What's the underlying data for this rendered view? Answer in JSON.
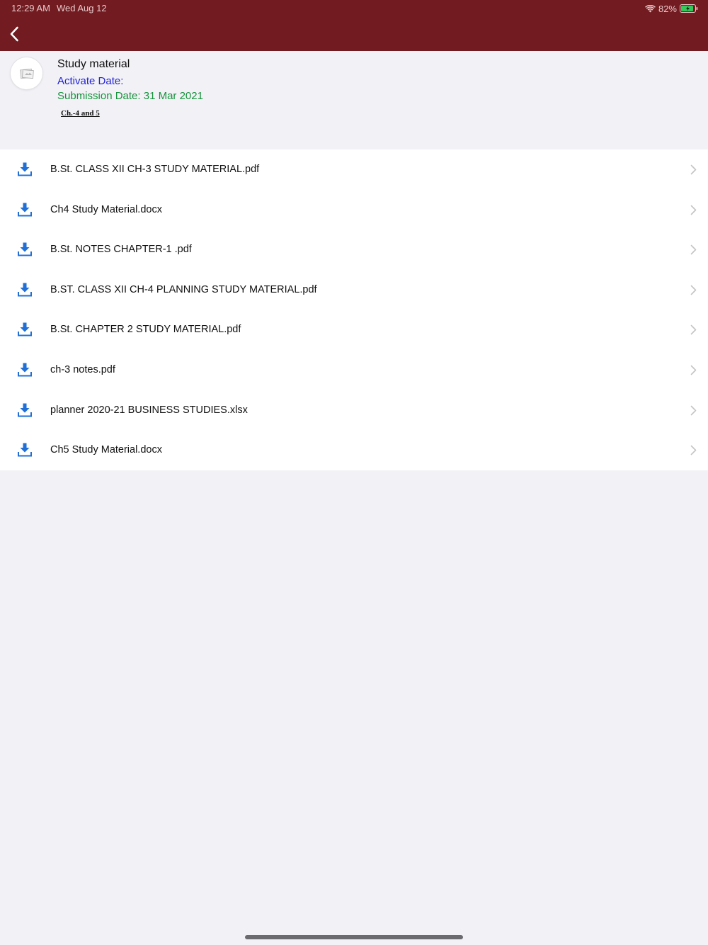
{
  "status_bar": {
    "time": "12:29 AM",
    "date": "Wed Aug 12",
    "battery": "82%",
    "wifi_icon": "wifi-icon",
    "battery_icon": "battery-charging-icon"
  },
  "nav": {
    "back_icon": "chevron-left-icon"
  },
  "header": {
    "title": "Study material",
    "activate_date": "Activate Date:",
    "submission_date": "Submission Date: 31 Mar 2021",
    "description": "Ch.-4 and 5",
    "avatar_icon": "document-thumbnail-icon"
  },
  "files": [
    "B.St. CLASS XII CH-3 STUDY MATERIAL.pdf",
    "Ch4 Study Material.docx",
    "B.St. NOTES CHAPTER-1 .pdf",
    "B.ST. CLASS XII CH-4 PLANNING STUDY MATERIAL.pdf",
    "B.St. CHAPTER 2 STUDY MATERIAL.pdf",
    "ch-3 notes.pdf",
    "planner 2020-21 BUSINESS STUDIES.xlsx",
    "Ch5 Study Material.docx"
  ],
  "colors": {
    "nav_bar": "#721b20",
    "activate_date": "#2323d4",
    "submission_date": "#17933c",
    "download_icon": "#1f6fd6",
    "background": "#f1f1f6"
  }
}
